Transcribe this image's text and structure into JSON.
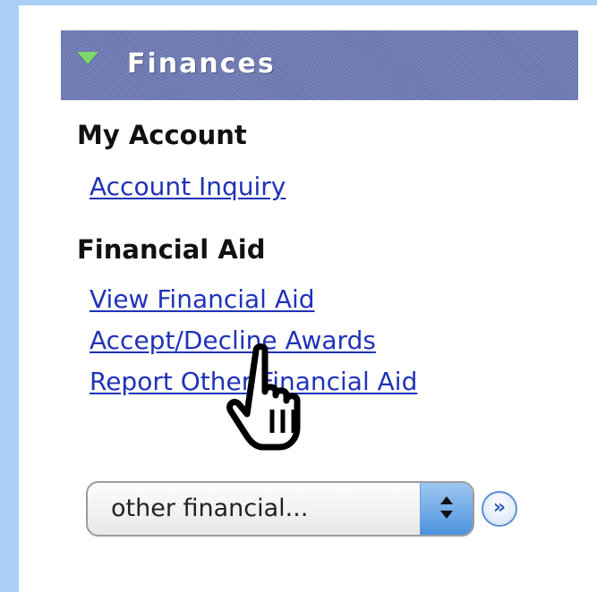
{
  "section": {
    "title": "Finances",
    "icon": "triangle-down-icon",
    "icon_color": "#79d96a",
    "header_color": "#6f7bb6"
  },
  "my_account": {
    "heading": "My Account",
    "links": [
      "Account Inquiry"
    ]
  },
  "financial_aid": {
    "heading": "Financial Aid",
    "links": [
      "View Financial Aid",
      "Accept/Decline Awards",
      "Report Other Financial Aid"
    ]
  },
  "dropdown": {
    "selected": "other financial..."
  },
  "go_button": {
    "label": "»"
  },
  "colors": {
    "link": "#2033b8",
    "background": "#a9cff6"
  }
}
